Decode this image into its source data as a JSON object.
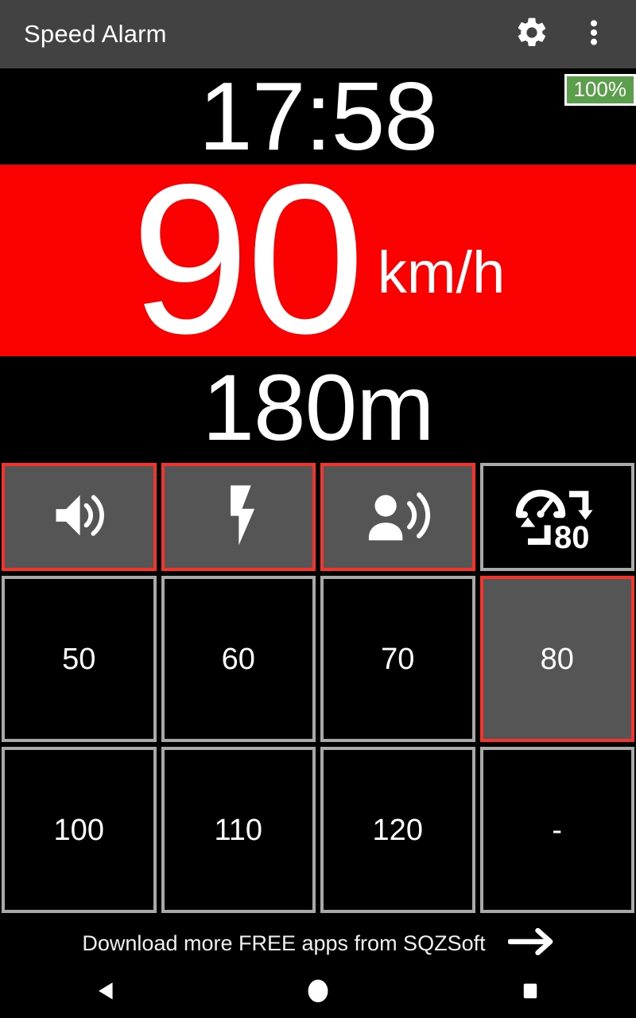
{
  "appbar": {
    "title": "Speed Alarm",
    "settings_icon": "gear-icon",
    "overflow_icon": "more-vertical-icon"
  },
  "status": {
    "clock": "17:58",
    "battery": "100%",
    "battery_color": "#5b9e4b"
  },
  "speed": {
    "value": "90",
    "unit": "km/h",
    "banner_color": "#fa0000",
    "over_limit": true
  },
  "distance": {
    "value": "180m"
  },
  "toggles": [
    {
      "name": "sound-alert-toggle",
      "icon": "volume-up-icon",
      "active": true,
      "label": ""
    },
    {
      "name": "flash-alert-toggle",
      "icon": "lightning-bolt-icon",
      "active": true,
      "label": ""
    },
    {
      "name": "voice-alert-toggle",
      "icon": "person-speaking-icon",
      "active": true,
      "label": ""
    },
    {
      "name": "speed-limit-auto",
      "icon": "speedometer-limit-icon",
      "active": false,
      "label": "80"
    }
  ],
  "presets": {
    "row2": [
      {
        "label": "50",
        "selected": false
      },
      {
        "label": "60",
        "selected": false
      },
      {
        "label": "70",
        "selected": false
      },
      {
        "label": "80",
        "selected": true
      }
    ],
    "row3": [
      {
        "label": "100",
        "selected": false
      },
      {
        "label": "110",
        "selected": false
      },
      {
        "label": "120",
        "selected": false
      },
      {
        "label": "-",
        "selected": false
      }
    ]
  },
  "promo": {
    "text": "Download more FREE apps from SQZSoft",
    "arrow_icon": "arrow-right-icon"
  },
  "navbar": {
    "back_icon": "triangle-back-icon",
    "home_icon": "circle-home-icon",
    "recents_icon": "square-recents-icon"
  },
  "colors": {
    "accent_red": "#f4342c",
    "alarm_red": "#fa0000",
    "active_fill": "#555555",
    "inactive_border": "#a9a9a9",
    "appbar": "#424242"
  }
}
